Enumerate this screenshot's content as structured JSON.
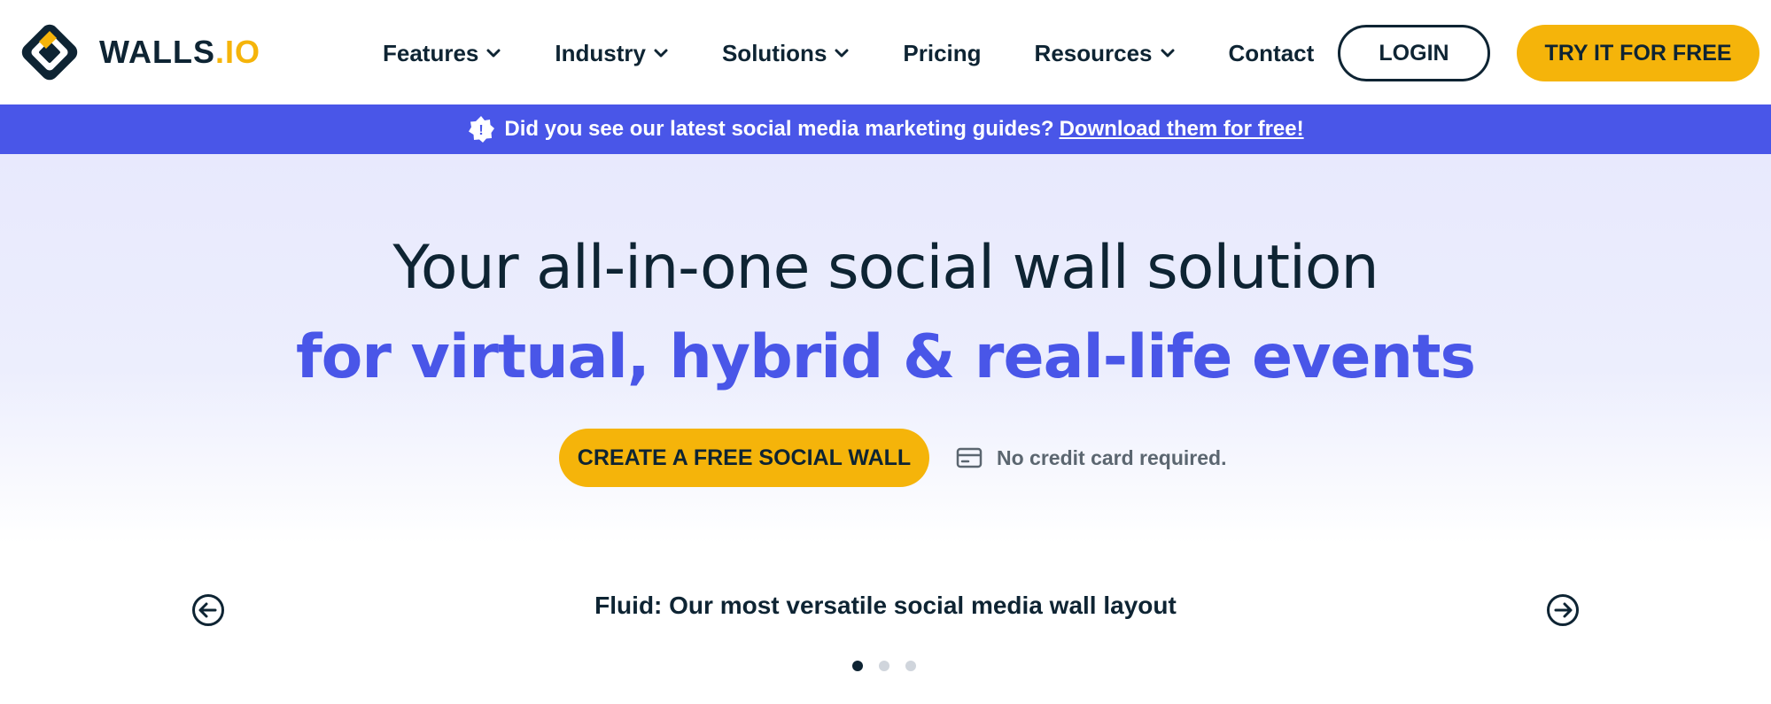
{
  "brand": {
    "name_main": "WALLS",
    "name_dot": ".",
    "name_suffix": "IO",
    "accent_color": "#f5b40a",
    "primary_color": "#4956e8",
    "dark_color": "#0e2433"
  },
  "nav": {
    "items": [
      {
        "label": "Features",
        "dropdown": true
      },
      {
        "label": "Industry",
        "dropdown": true
      },
      {
        "label": "Solutions",
        "dropdown": true
      },
      {
        "label": "Pricing",
        "dropdown": false
      },
      {
        "label": "Resources",
        "dropdown": true
      },
      {
        "label": "Contact",
        "dropdown": false
      }
    ],
    "login_label": "LOGIN",
    "try_label": "TRY IT FOR FREE"
  },
  "banner": {
    "icon": "star-badge-icon",
    "text": "Did you see our latest social media marketing guides?",
    "link_text": "Download them for free!"
  },
  "hero": {
    "title": "Your all-in-one social wall solution",
    "subtitle": "for virtual, hybrid & real-life events",
    "cta_label": "CREATE A FREE SOCIAL WALL",
    "note_icon": "credit-card-icon",
    "note_text": "No credit card required."
  },
  "slider": {
    "caption": "Fluid: Our most versatile social media wall layout",
    "prev_icon": "arrow-left-circle-icon",
    "next_icon": "arrow-right-circle-icon",
    "dot_count": 3,
    "active_index": 0
  }
}
